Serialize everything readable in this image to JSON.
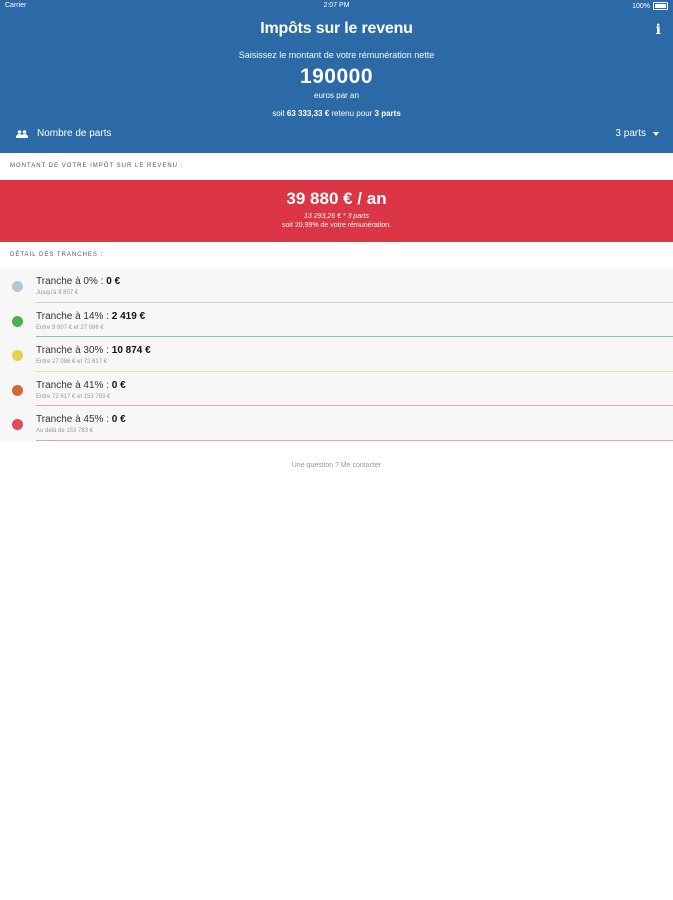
{
  "status": {
    "carrier": "Carrier",
    "time": "2:07 PM",
    "battery": "100%"
  },
  "header": {
    "title": "Impôts sur le revenu",
    "info": "i",
    "prompt": "Saisissez le montant de votre rémunération nette",
    "amount": "190000",
    "unit": "euros par an",
    "revenue_prefix": "soit",
    "revenue_value": "63 333,33 €",
    "revenue_mid": "retenu pour",
    "revenue_parts": "3 parts"
  },
  "parts": {
    "label": "Nombre de parts",
    "value": "3 parts"
  },
  "impot": {
    "section_label": "MONTANT DE VOTRE IMPÔT SUR LE REVENU :",
    "main": "39 880 € / an",
    "detail": "13 293,26 € * 3 parts",
    "ratio": "soit 20,99% de votre rémunération."
  },
  "tranches_label": "DÉTAIL DES TRANCHES :",
  "tranches": [
    {
      "label": "Tranche à 0% : ",
      "amount": "0 €",
      "range": "Jusqu'à 9 807 €",
      "color": "#b4c7cf",
      "line": "#c5d4da"
    },
    {
      "label": "Tranche à 14% : ",
      "amount": "2 419 €",
      "range": "Entre 9 807 € et 27 086 €",
      "color": "#4caf50",
      "line": "#8bc98d"
    },
    {
      "label": "Tranche à 30% : ",
      "amount": "10 874 €",
      "range": "Entre 27 086 € et 72 617 €",
      "color": "#e4d24a",
      "line": "#ece08a"
    },
    {
      "label": "Tranche à 41% : ",
      "amount": "0 €",
      "range": "Entre 72 617 € et 153 783 €",
      "color": "#d2693b",
      "line": "#e6ab93"
    },
    {
      "label": "Tranche à 45% : ",
      "amount": "0 €",
      "range": "Au delà de 153 783 €",
      "color": "#e04a5a",
      "line": "#eda3aa"
    }
  ],
  "footer": {
    "contact": "Une question ? Me contacter"
  }
}
